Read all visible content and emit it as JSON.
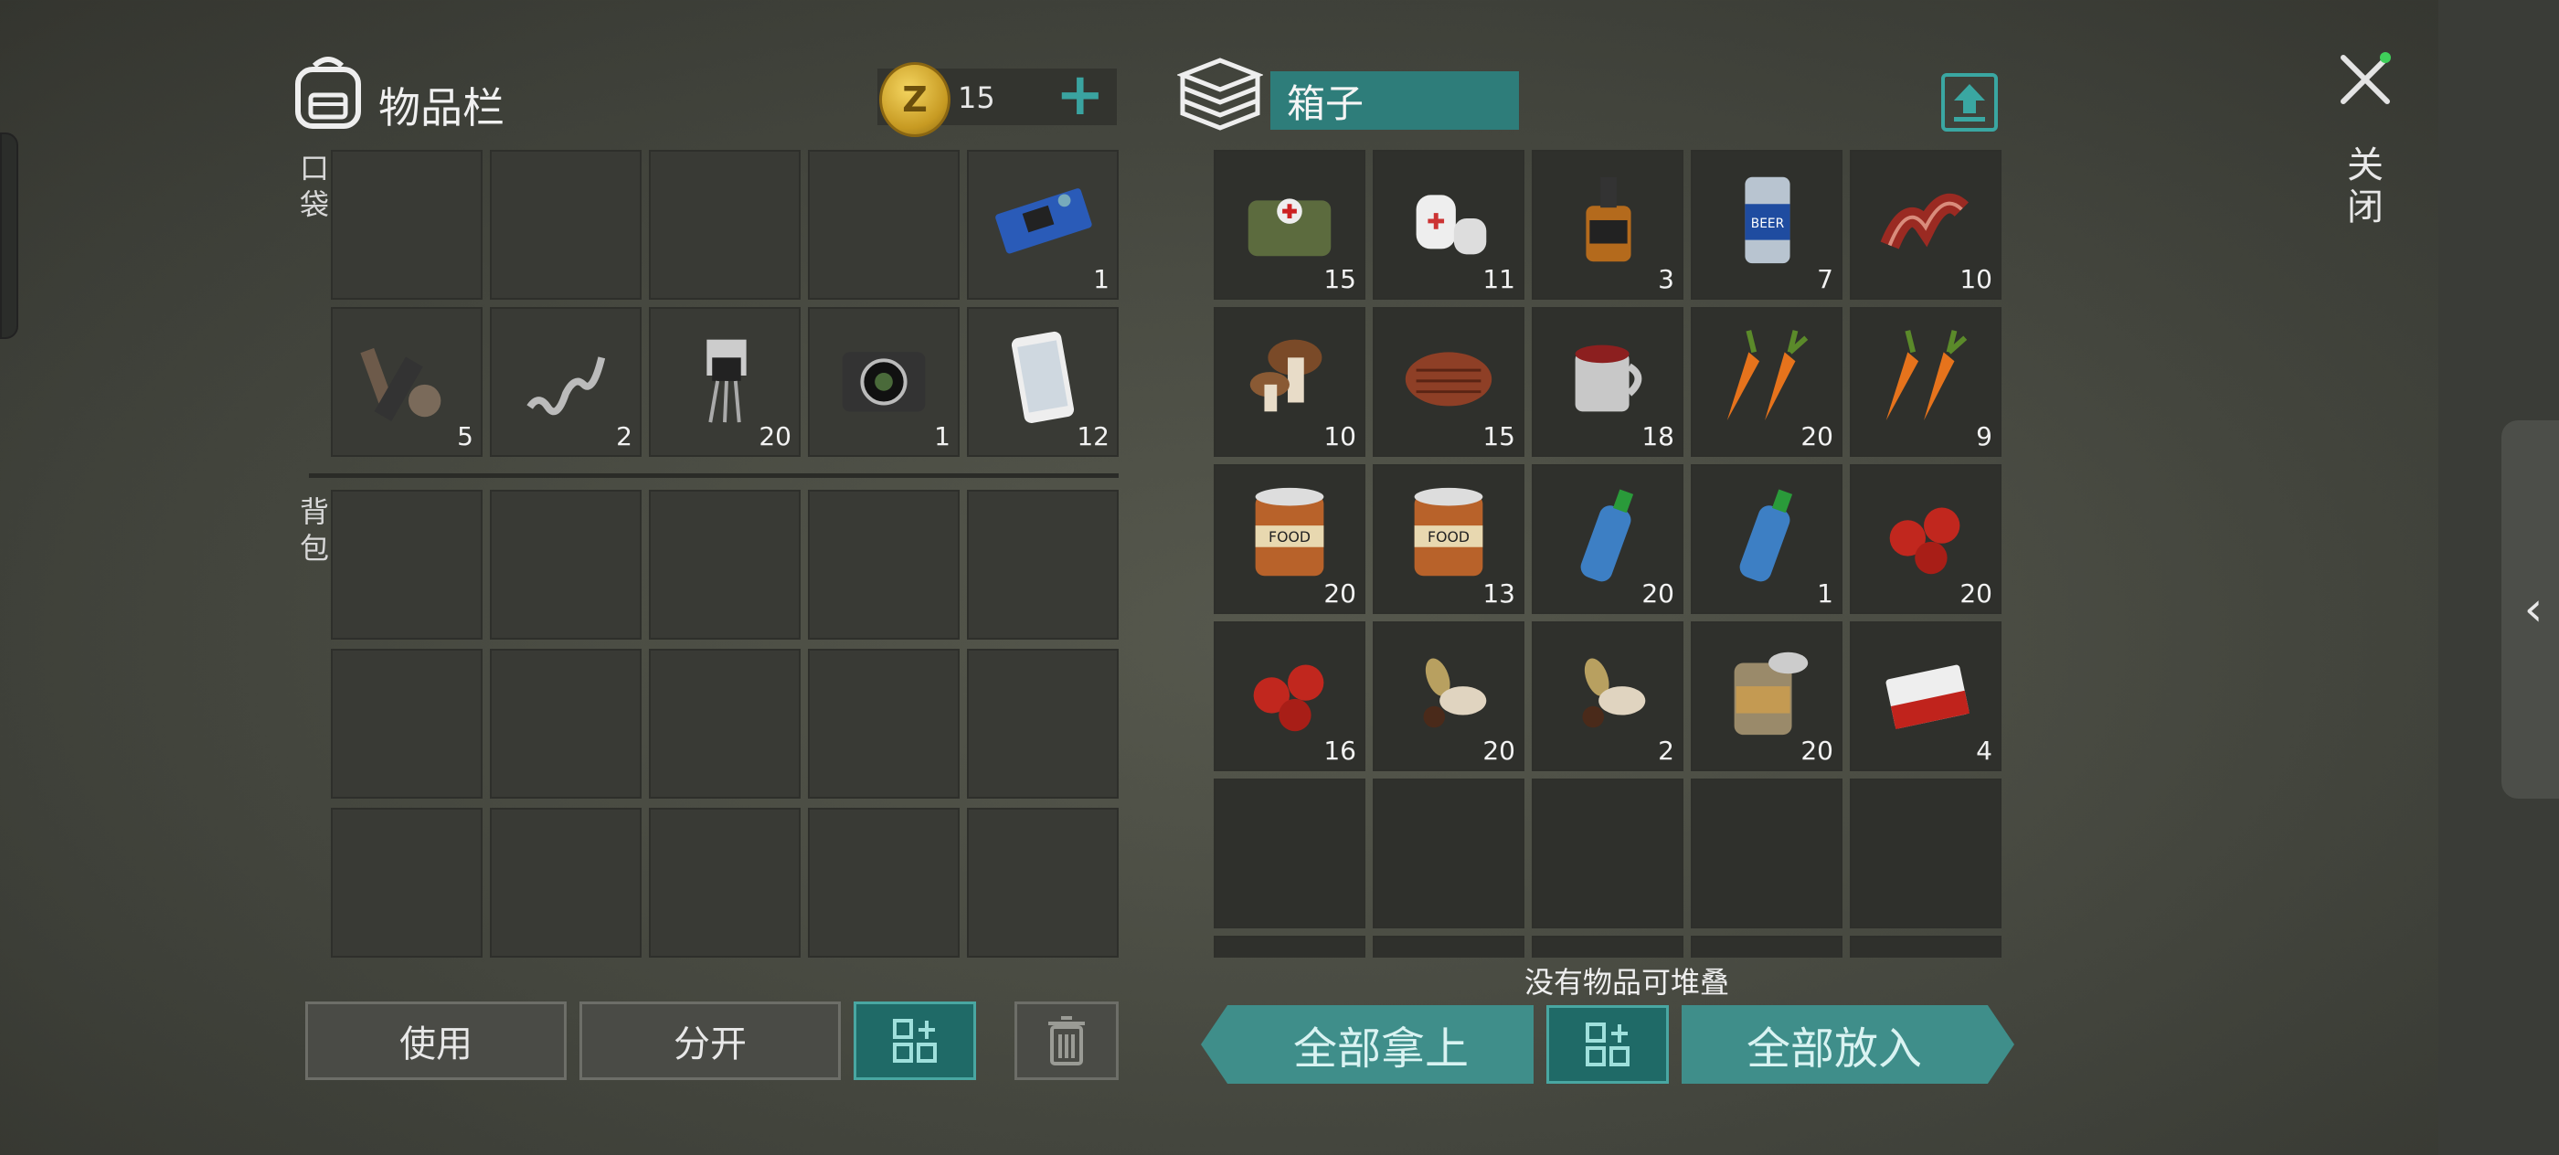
{
  "inventory": {
    "title": "物品栏",
    "coins": "15",
    "pocket_label": "口袋",
    "backpack_label": "背包",
    "pocket_row1": [
      {
        "icon": "",
        "count": ""
      },
      {
        "icon": "",
        "count": ""
      },
      {
        "icon": "",
        "count": ""
      },
      {
        "icon": "",
        "count": ""
      },
      {
        "icon": "circuit-board-icon",
        "count": "1"
      }
    ],
    "pocket_row2": [
      {
        "icon": "scrap-parts-icon",
        "count": "5"
      },
      {
        "icon": "spring-icon",
        "count": "2"
      },
      {
        "icon": "transistor-icon",
        "count": "20"
      },
      {
        "icon": "camera-icon",
        "count": "1"
      },
      {
        "icon": "smartphone-icon",
        "count": "12"
      }
    ],
    "buttons": {
      "use": "使用",
      "split": "分开"
    }
  },
  "box": {
    "title": "箱子",
    "items": [
      {
        "icon": "first-aid-bag-icon",
        "count": "15"
      },
      {
        "icon": "bandage-icon",
        "count": "11"
      },
      {
        "icon": "whiskey-bottle-icon",
        "count": "3"
      },
      {
        "icon": "beer-can-icon",
        "count": "7"
      },
      {
        "icon": "bacon-icon",
        "count": "10"
      },
      {
        "icon": "mushroom-icon",
        "count": "10"
      },
      {
        "icon": "steak-icon",
        "count": "15"
      },
      {
        "icon": "tea-mug-icon",
        "count": "18"
      },
      {
        "icon": "carrot-icon",
        "count": "20"
      },
      {
        "icon": "carrot-icon",
        "count": "9"
      },
      {
        "icon": "canned-food-icon",
        "count": "20"
      },
      {
        "icon": "canned-food-icon",
        "count": "13"
      },
      {
        "icon": "water-bottle-icon",
        "count": "20"
      },
      {
        "icon": "water-bottle-icon",
        "count": "1"
      },
      {
        "icon": "berries-icon",
        "count": "20"
      },
      {
        "icon": "berries-icon",
        "count": "16"
      },
      {
        "icon": "seeds-icon",
        "count": "20"
      },
      {
        "icon": "seeds-icon",
        "count": "2"
      },
      {
        "icon": "open-can-icon",
        "count": "20"
      },
      {
        "icon": "cigarettes-icon",
        "count": "4"
      }
    ],
    "stack_message": "没有物品可堆叠",
    "take_all": "全部拿上",
    "put_all": "全部放入"
  },
  "close_label": "关闭",
  "colors": {
    "teal": "#3aa3a0",
    "slot": "#393a35",
    "background": "#4a4c43"
  }
}
